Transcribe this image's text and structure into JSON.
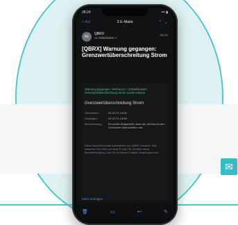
{
  "status_bar": {
    "time": "08:24",
    "icons": "••• ▮"
  },
  "topbar": {
    "back_label": "< Ale",
    "title": "3 E-Mails",
    "nav_up": "⌃",
    "nav_down": "⌄"
  },
  "message": {
    "avatar_initials": "AE",
    "sender": "QBRX",
    "recipient": "An Mitarbeiter >",
    "time": "08:24",
    "subject": "[QBRX] Warnung gegangen: Grenzwertüberschreitung Strom"
  },
  "card": {
    "warning_lines": [
      "Warnung gegangen: Verbrauch > Schwellenwert",
      "Grenzwertüberschreitung Strom wurde erkannt"
    ],
    "title": "Grenzwertüberschreitung Strom",
    "rows": [
      {
        "k": "Gekommen",
        "v": "01.02.21 14:00"
      },
      {
        "k": "Gegangen",
        "v": "01.02.21 14:30"
      },
      {
        "k": "Beschreibung",
        "v": "Es wurde festgestellt, dass der Verbrauch den Grenzwert überschritten hat."
      }
    ],
    "footer": "Diese Nachricht wurde automatisch von QBRX versandt. Bitte antworten Sie nicht auf diese E-Mail. Sie erhalten diese Benachrichtigung, weil Sie für dieses Ereignis eingetragen sind."
  },
  "bottom_bar": {
    "attachment_label": "Mehr anzeigen",
    "icons": [
      "trash",
      "folder",
      "reply",
      "compose"
    ]
  },
  "decor": {
    "mail_glyph": "✉"
  },
  "colors": {
    "accent": "#36bcc7",
    "ring": "#52c6cf"
  }
}
